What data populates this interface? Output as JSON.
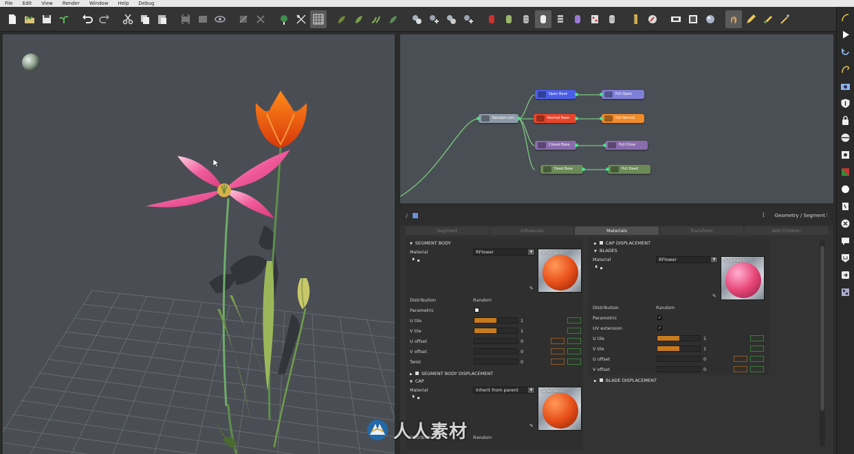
{
  "menubar": {
    "items": [
      "File",
      "Edit",
      "View",
      "Render",
      "Window",
      "Help",
      "Debug"
    ]
  },
  "toolbar": {
    "groups": [
      [
        "new-file-icon",
        "open-file-icon",
        "save-icon",
        "plant-open-icon"
      ],
      [
        "undo-icon",
        "redo-icon"
      ],
      [
        "cut-icon",
        "copy-icon",
        "paste-icon"
      ],
      [
        "group-icon",
        "ungroup-icon",
        "eye-icon"
      ],
      [
        "disable-icon",
        "delete-icon"
      ],
      [
        "grow-plant-icon",
        "prune-icon",
        "grid-icon"
      ],
      [
        "leaf-tool-1-icon",
        "leaf-tool-2-icon",
        "leaf-tool-3-icon",
        "leaf-tool-4-icon"
      ],
      [
        "material-1-icon",
        "material-2-icon",
        "material-3-icon",
        "material-4-icon"
      ],
      [
        "cylinder-red-icon",
        "cylinder-green-icon",
        "cylinder-grey-icon",
        "cylinder-white-icon",
        "cylinder-stack-icon",
        "cylinder-purple-icon",
        "cylinder-pattern-icon",
        "cylinder-dots-icon"
      ],
      [
        "ruler-icon",
        "compass-icon"
      ],
      [
        "film-icon",
        "frame-icon",
        "render-sphere-icon"
      ],
      [
        "hand-tool-icon",
        "pencil-tool-icon",
        "brush-tool-icon",
        "wand-tool-icon"
      ]
    ]
  },
  "rightstrip": {
    "icons": [
      "curve-tool-icon",
      "play-icon",
      "refresh-icon",
      "spiral-icon",
      "camera-icon",
      "shield-icon",
      "lock-icon",
      "sphere-stripe-icon",
      "share-icon",
      "color-swatch-icon",
      "circle-icon",
      "script-icon",
      "close-circle-icon",
      "chat-icon",
      "badge-icon",
      "export-icon",
      "qr-icon"
    ]
  },
  "graph": {
    "nodes": [
      {
        "id": "random",
        "label": "Random chil...",
        "color": "#8e9aa8"
      },
      {
        "id": "open_base",
        "label": "Open Base",
        "color": "#4c5ee8"
      },
      {
        "id": "normal_base",
        "label": "Normal Base",
        "color": "#e8452a"
      },
      {
        "id": "closed_base",
        "label": "Closed Base",
        "color": "#8a6cae"
      },
      {
        "id": "dead_base",
        "label": "Dead Base",
        "color": "#6c8a58"
      },
      {
        "id": "pull_open",
        "label": "Pull Open",
        "color": "#8080d8"
      },
      {
        "id": "pull_normal",
        "label": "Pull Normal",
        "color": "#f08a2a"
      },
      {
        "id": "pull_close",
        "label": "Pull Close",
        "color": "#8a6cae"
      },
      {
        "id": "pull_dead",
        "label": "Pull Dead",
        "color": "#6c8a58"
      }
    ]
  },
  "props": {
    "breadcrumb": "Geometry / Segment",
    "tabs": [
      "Segment",
      "Influences",
      "Materials",
      "Transform",
      "Add Children"
    ],
    "active_tab": "Materials",
    "left": {
      "segment_body_title": "SEGMENT BODY",
      "material_label": "Material",
      "material_value": "RFlower",
      "thumb_label": "Parametric",
      "distribution_label": "Distribution",
      "distribution_value": "Random",
      "parametric_label": "Parametric",
      "u_tile_label": "U tile",
      "u_tile_value": "1",
      "v_tile_label": "V tile",
      "v_tile_value": "1",
      "u_offset_label": "U offset",
      "u_offset_value": "0",
      "v_offset_label": "V offset",
      "v_offset_value": "0",
      "twist_label": "Twist",
      "twist_value": "0",
      "segment_body_disp_title": "SEGMENT BODY DISPLACEMENT",
      "cap_title": "CAP",
      "cap_material_label": "Material",
      "cap_material_value": "Inherit from parent",
      "cap_thumb_label": "Parametric",
      "cap_distribution_label": "Distribution",
      "cap_distribution_value": "Random"
    },
    "right": {
      "cap_disp_title": "CAP DISPLACEMENT",
      "blades_title": "BLADES",
      "material_label": "Material",
      "material_value": "RFlower",
      "thumb_label": "Parametric",
      "distribution_label": "Distribution",
      "distribution_value": "Random",
      "parametric_label": "Parametric",
      "uv_extension_label": "UV extension",
      "u_tile_label": "U tile",
      "u_tile_value": "1",
      "v_tile_label": "V tile",
      "v_tile_value": "1",
      "u_offset_label": "U offset",
      "u_offset_value": "0",
      "v_offset_label": "V offset",
      "v_offset_value": "0",
      "blade_disp_title": "BLADE DISPLACEMENT"
    }
  },
  "watermark": {
    "text": "人人素材"
  },
  "colors": {
    "accent_orange": "#c87a1c",
    "graph_link": "#7ec87e",
    "viewport_bg": "#4a4e54",
    "ball_orange": "#e8501a",
    "ball_pink": "#e8487a"
  }
}
